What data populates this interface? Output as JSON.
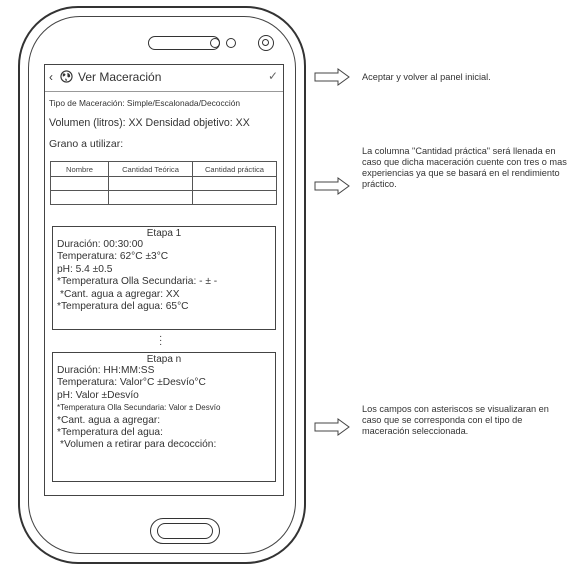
{
  "header": {
    "title": "Ver Maceración",
    "back_icon": "‹",
    "check_icon": "✓"
  },
  "recipe": {
    "tipo": "Tipo de Maceración: Simple/Escalonada/Decocción",
    "volumen": "Volumen (litros): XX   Densidad objetivo: XX",
    "grano_label": "Grano a utilizar:"
  },
  "grain_table": {
    "columns": [
      "Nombre",
      "Cantidad Teórica",
      "Cantidad práctica"
    ],
    "rows": [
      [
        "",
        "",
        ""
      ],
      [
        "",
        "",
        ""
      ]
    ]
  },
  "etapa1": {
    "title": "Etapa 1",
    "duracion": "Duración: 00:30:00",
    "temperatura": "Temperatura: 62°C  ±3°C",
    "ph": "pH: 5.4 ±0.5",
    "temp_olla": "*Temperatura Olla Secundaria: - ± -",
    "cant_agua": "*Cant. agua a agregar: XX",
    "temp_agua": "*Temperatura del agua:  65°C"
  },
  "etapan": {
    "title": "Etapa n",
    "duracion": "Duración: HH:MM:SS",
    "temperatura": "Temperatura: Valor°C  ±Desvío°C",
    "ph": "pH: Valor ±Desvío",
    "temp_olla": "*Temperatura Olla Secundaria: Valor ± Desvío",
    "cant_agua": "*Cant. agua a agregar:",
    "temp_agua": "*Temperatura del agua:",
    "volumen_retirar": "*Volumen a retirar para decocción:"
  },
  "annotations": {
    "a1": "Aceptar y volver al panel inicial.",
    "a2": "La columna \"Cantidad práctica\" será llenada en caso que dicha maceración cuente con tres o mas experiencias ya que se basará en el rendimiento práctico.",
    "a3": "Los campos con asteriscos se visualizaran en caso que se corresponda con el tipo de maceración seleccionada."
  }
}
